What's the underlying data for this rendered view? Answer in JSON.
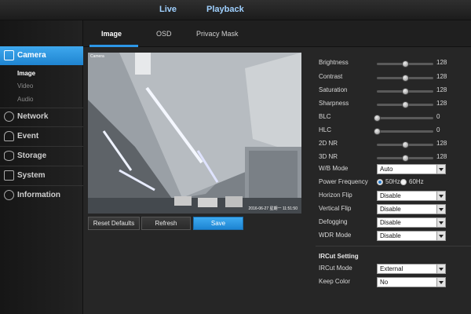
{
  "topbar": {
    "tabs": [
      "Live",
      "Playback"
    ]
  },
  "sidebar": {
    "items": [
      {
        "label": "Camera",
        "icon": "camera-icon",
        "active": true
      },
      {
        "label": "Network",
        "icon": "network-icon"
      },
      {
        "label": "Event",
        "icon": "event-icon"
      },
      {
        "label": "Storage",
        "icon": "storage-icon"
      },
      {
        "label": "System",
        "icon": "system-icon"
      },
      {
        "label": "Information",
        "icon": "information-icon"
      }
    ],
    "camera_subitems": [
      "Image",
      "Video",
      "Audio"
    ]
  },
  "subtabs": [
    "Image",
    "OSD",
    "Privacy Mask"
  ],
  "video": {
    "label": "Camera",
    "timestamp": "2016-06-27 星期一 11:51:50"
  },
  "buttons": {
    "reset": "Reset Defaults",
    "refresh": "Refresh",
    "save": "Save"
  },
  "sliders": [
    {
      "label": "Brightness",
      "value": 128
    },
    {
      "label": "Contrast",
      "value": 128
    },
    {
      "label": "Saturation",
      "value": 128
    },
    {
      "label": "Sharpness",
      "value": 128
    },
    {
      "label": "BLC",
      "value": 0
    },
    {
      "label": "HLC",
      "value": 0
    },
    {
      "label": "2D NR",
      "value": 128
    },
    {
      "label": "3D NR",
      "value": 128
    }
  ],
  "slider_max": 255,
  "wb_mode": {
    "label": "W/B Mode",
    "value": "Auto"
  },
  "power_frequency": {
    "label": "Power Frequency",
    "options": [
      "50Hz",
      "60Hz"
    ],
    "selected": "50Hz"
  },
  "selects": [
    {
      "label": "Horizon Flip",
      "value": "Disable"
    },
    {
      "label": "Vertical Flip",
      "value": "Disable"
    },
    {
      "label": "Defogging",
      "value": "Disable"
    },
    {
      "label": "WDR Mode",
      "value": "Disable"
    }
  ],
  "ircut": {
    "title": "IRCut Setting",
    "mode": {
      "label": "IRCut Mode",
      "value": "External"
    },
    "keep_color": {
      "label": "Keep Color",
      "value": "No"
    }
  },
  "colors": {
    "accent": "#2c96e6",
    "active_tab_text": "#9fd0ff"
  }
}
